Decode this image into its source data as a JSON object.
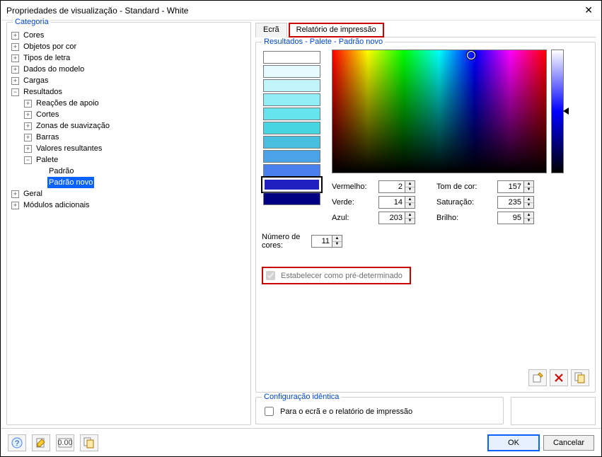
{
  "window": {
    "title": "Propriedades de visualização - Standard - White"
  },
  "left": {
    "legend": "Categoria",
    "tree": {
      "cores": "Cores",
      "objetos": "Objetos por cor",
      "tipos": "Tipos de letra",
      "dados": "Dados do modelo",
      "cargas": "Cargas",
      "resultados": "Resultados",
      "reacoes": "Reações de apoio",
      "cortes": "Cortes",
      "zonas": "Zonas de suavização",
      "barras": "Barras",
      "valores": "Valores resultantes",
      "palete": "Palete",
      "padrao": "Padrão",
      "padrao_novo": "Padrão novo",
      "geral": "Geral",
      "modulos": "Módulos adicionais"
    }
  },
  "tabs": {
    "ecra": "Ecrã",
    "relatorio": "Relatório de impressão"
  },
  "palette_group": {
    "legend": "Resultados - Palete - Padrão novo",
    "swatches": [
      "#ffffff",
      "#e6fbff",
      "#c1f5fb",
      "#92eef6",
      "#66e4ed",
      "#48d5e2",
      "#49bfe0",
      "#4aa3e6",
      "#4a80ee",
      "#2020c0",
      "#000080"
    ],
    "selected_swatch_index": 9,
    "rgb": {
      "label_r": "Vermelho:",
      "label_g": "Verde:",
      "label_b": "Azul:",
      "r": "2",
      "g": "14",
      "b": "203"
    },
    "hsv": {
      "label_h": "Tom de cor:",
      "label_s": "Saturação:",
      "label_v": "Brilho:",
      "h": "157",
      "s": "235",
      "v": "95"
    },
    "numcolors_label": "Número de cores:",
    "numcolors": "11",
    "preset_label": "Estabelecer como pré-determinado",
    "sv_cursor": {
      "left_pct": 65,
      "top_pct": 4
    }
  },
  "config_group": {
    "legend": "Configuração idêntica",
    "checkbox_label": "Para o ecrã e o relatório de impressão"
  },
  "buttons": {
    "ok": "OK",
    "cancel": "Cancelar"
  }
}
